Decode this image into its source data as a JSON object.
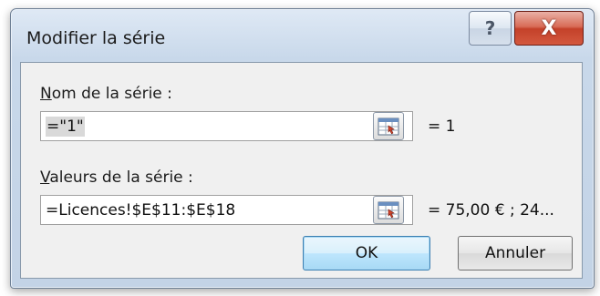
{
  "window": {
    "title": "Modifier la série",
    "help_glyph": "?",
    "close_glyph": "X"
  },
  "series_name": {
    "label_accel": "N",
    "label_rest": "om de la série :",
    "value": "=\"1\"",
    "preview": "= 1"
  },
  "series_values": {
    "label_accel": "V",
    "label_rest": "aleurs de la série :",
    "value": "=Licences!$E$11:$E$18",
    "preview": "=  75,00 € ;  24..."
  },
  "buttons": {
    "ok": "OK",
    "cancel": "Annuler"
  },
  "colors": {
    "close_button": "#c4412a",
    "default_button_border": "#3c7fb1"
  }
}
